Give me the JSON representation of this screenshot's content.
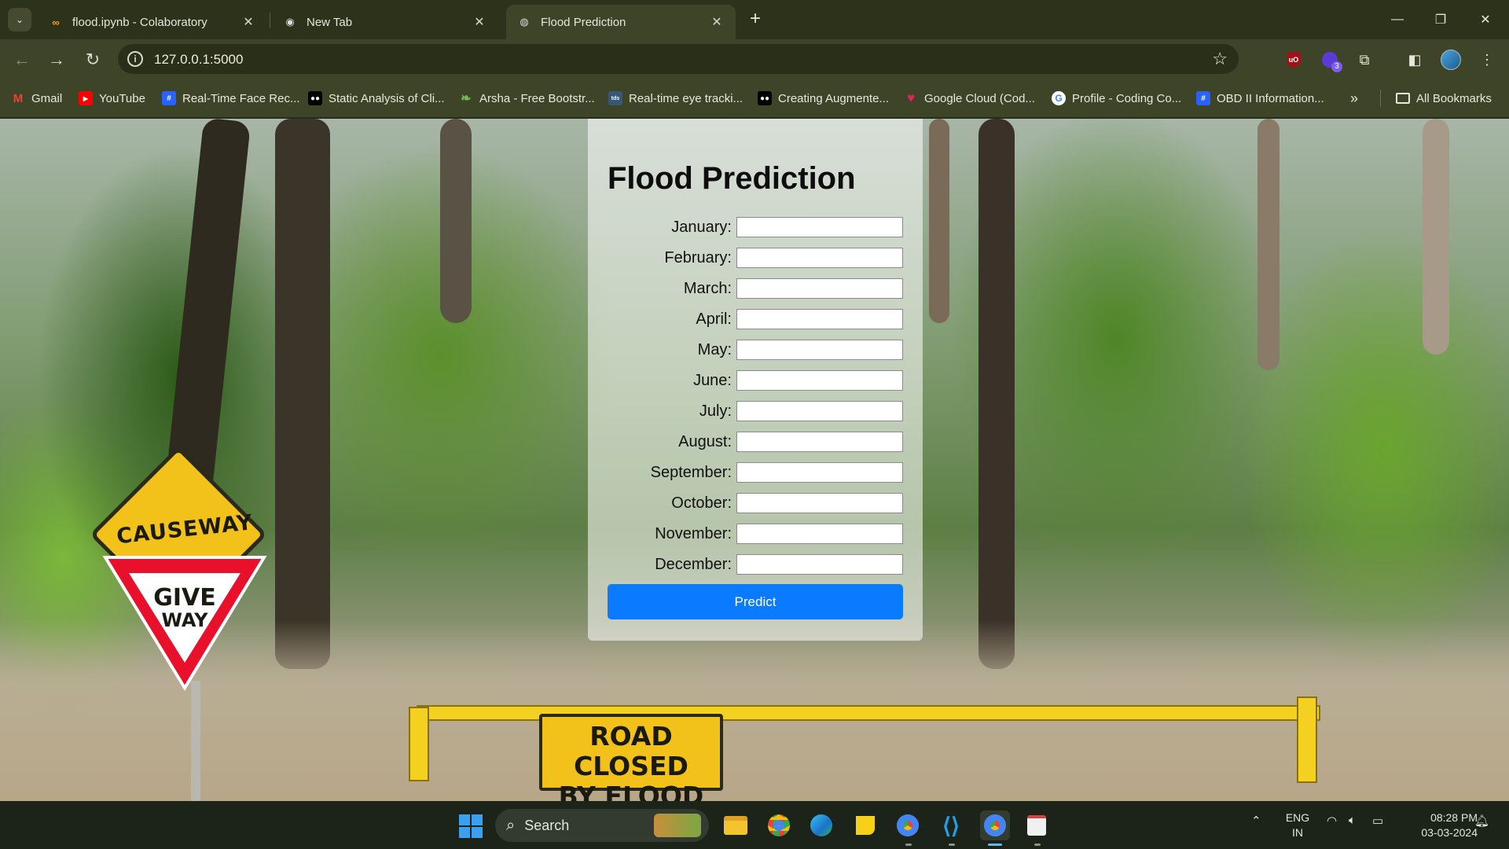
{
  "browser": {
    "tabs": [
      {
        "title": "flood.ipynb - Colaboratory",
        "favicon": "colab-icon",
        "active": false
      },
      {
        "title": "New Tab",
        "favicon": "chrome-icon",
        "active": false
      },
      {
        "title": "Flood Prediction",
        "favicon": "globe-icon",
        "active": true
      }
    ],
    "url": "127.0.0.1:5000",
    "bookmarks": [
      {
        "label": "Gmail",
        "icon": "gmail-icon",
        "color": "#ea4335",
        "glyph": "M"
      },
      {
        "label": "YouTube",
        "icon": "youtube-icon",
        "color": "#ff0000",
        "glyph": "▶"
      },
      {
        "label": "Real-Time Face Rec...",
        "icon": "hashnode-icon",
        "color": "#2962ff",
        "glyph": "#"
      },
      {
        "label": "Static Analysis of Cli...",
        "icon": "medium-icon",
        "color": "#111111",
        "glyph": "●"
      },
      {
        "label": "Arsha - Free Bootstr...",
        "icon": "leaf-icon",
        "color": "#47b2e4",
        "glyph": "A"
      },
      {
        "label": "Real-time eye tracki...",
        "icon": "tds-icon",
        "color": "#355876",
        "glyph": "tds"
      },
      {
        "label": "Creating Augmente...",
        "icon": "medium-icon",
        "color": "#111111",
        "glyph": "●"
      },
      {
        "label": "Google Cloud (Cod...",
        "icon": "heart-icon",
        "color": "#e0245e",
        "glyph": "♥"
      },
      {
        "label": "Profile - Coding Co...",
        "icon": "google-icon",
        "color": "#ffffff",
        "glyph": "G"
      },
      {
        "label": "OBD II Information...",
        "icon": "hashnode-icon",
        "color": "#2962ff",
        "glyph": "#"
      }
    ],
    "all_bookmarks": "All Bookmarks",
    "extension_badge": "3"
  },
  "page": {
    "title": "Flood Prediction",
    "fields": [
      {
        "label": "January:",
        "value": ""
      },
      {
        "label": "February:",
        "value": ""
      },
      {
        "label": "March:",
        "value": ""
      },
      {
        "label": "April:",
        "value": ""
      },
      {
        "label": "May:",
        "value": ""
      },
      {
        "label": "June:",
        "value": ""
      },
      {
        "label": "July:",
        "value": ""
      },
      {
        "label": "August:",
        "value": ""
      },
      {
        "label": "September:",
        "value": ""
      },
      {
        "label": "October:",
        "value": ""
      },
      {
        "label": "November:",
        "value": ""
      },
      {
        "label": "December:",
        "value": ""
      }
    ],
    "button_label": "Predict",
    "background_signs": {
      "causeway": "CAUSEWAY",
      "give_way_1": "GIVE",
      "give_way_2": "WAY",
      "road_closed_1": "ROAD CLOSED",
      "road_closed_2": "BY FLOOD"
    }
  },
  "taskbar": {
    "search_label": "Search",
    "lang_1": "ENG",
    "lang_2": "IN",
    "time": "08:28 PM",
    "date": "03-03-2024"
  },
  "colors": {
    "accent": "#0a7bff",
    "chrome_toolbar": "#3e4427",
    "chrome_tabbar": "#2d321a"
  }
}
